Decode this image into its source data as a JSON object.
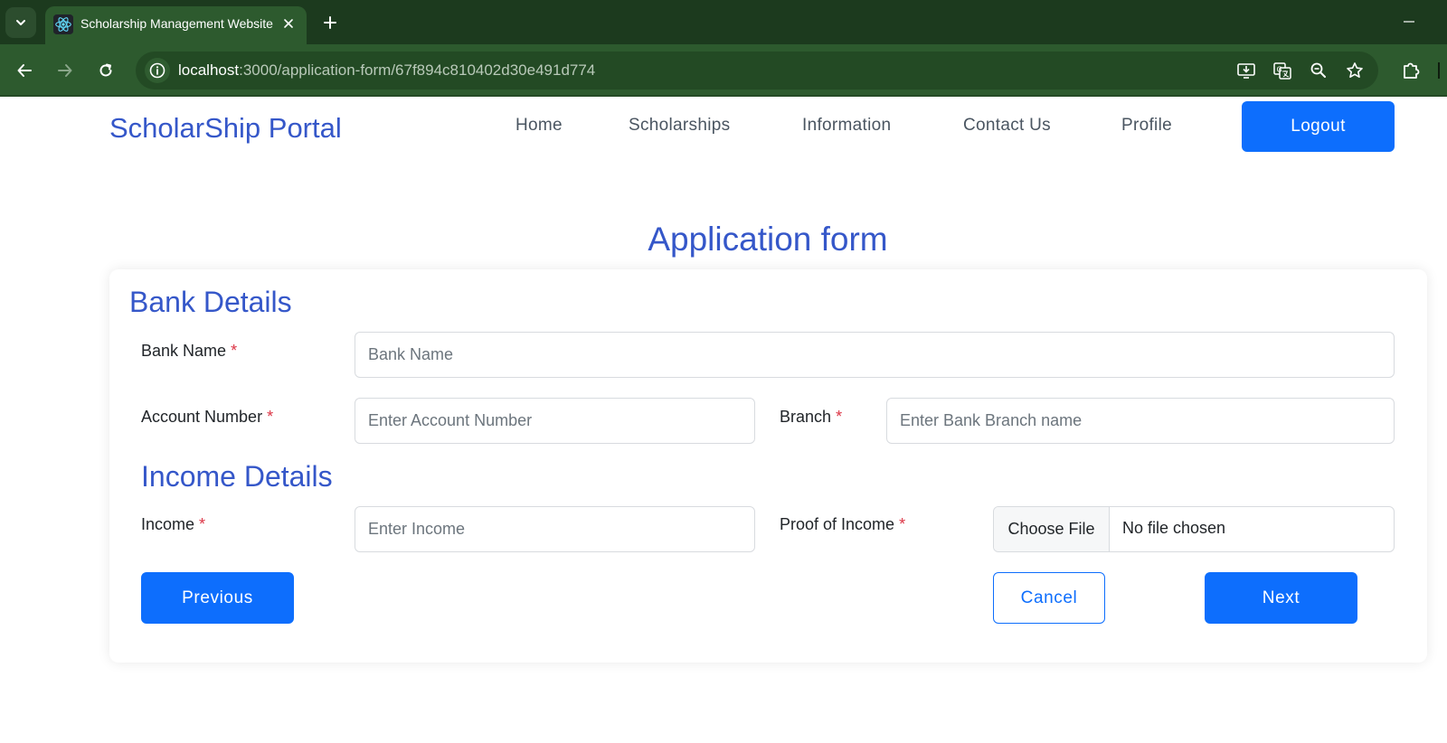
{
  "browser": {
    "tab_title": "Scholarship Management Website",
    "url_host": "localhost",
    "url_path": ":3000/application-form/67f894c810402d30e491d774"
  },
  "navbar": {
    "brand": "ScholarShip Portal",
    "links": [
      "Home",
      "Scholarships",
      "Information",
      "Contact Us",
      "Profile"
    ],
    "logout_label": "Logout"
  },
  "page": {
    "title": "Application form"
  },
  "bank": {
    "section_title": "Bank Details",
    "bank_name_label": "Bank Name",
    "bank_name_placeholder": "Bank Name",
    "account_label": "Account Number",
    "account_placeholder": "Enter Account Number",
    "branch_label": "Branch",
    "branch_placeholder": "Enter Bank Branch name"
  },
  "income": {
    "section_title": "Income Details",
    "income_label": "Income",
    "income_placeholder": "Enter Income",
    "proof_label": "Proof of Income",
    "file_button": "Choose File",
    "file_status": "No file chosen"
  },
  "required_marker": "*",
  "actions": {
    "previous": "Previous",
    "cancel": "Cancel",
    "next": "Next"
  },
  "colors": {
    "accent": "#0d6efd",
    "heading": "#3557c9",
    "required": "#dc3545",
    "chrome": "#2d5a2e"
  }
}
